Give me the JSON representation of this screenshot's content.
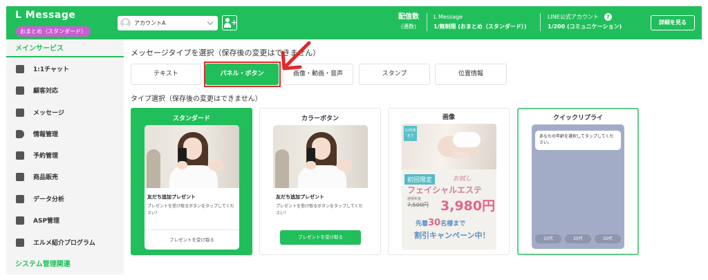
{
  "header": {
    "brand": "L Message",
    "plan_badge": "おまとめ（スタンダード）",
    "account_name": "アカウントA",
    "stats": {
      "delivery_label": "配信数",
      "delivery_sub": "(通数)",
      "plan_app": "L Message",
      "plan_value": "1/無制限 (おまとめ（スタンダード）)",
      "line_label": "LINE公式アカウント",
      "line_value": "1/200 (コミュニケーション)"
    },
    "detail_button": "詳細を見る"
  },
  "sidebar": {
    "main_section": "メインサービス",
    "items": [
      {
        "label": "1:1チャット",
        "icon": "chat-icon"
      },
      {
        "label": "顧客対応",
        "icon": "edit-icon"
      },
      {
        "label": "メッセージ",
        "icon": "message-icon"
      },
      {
        "label": "情報管理",
        "icon": "tag-icon"
      },
      {
        "label": "予約管理",
        "icon": "calendar-icon"
      },
      {
        "label": "商品販売",
        "icon": "cart-icon"
      },
      {
        "label": "データ分析",
        "icon": "chart-icon"
      },
      {
        "label": "ASP管理",
        "icon": "asp-icon"
      },
      {
        "label": "エルメ紹介プログラム",
        "icon": "badge-icon"
      }
    ],
    "system_section": "システム管理関連"
  },
  "main": {
    "message_type_title": "メッセージタイプを選択（保存後の変更はできません）",
    "message_types": [
      "テキスト",
      "パネル・ボタン",
      "画像・動画・音声",
      "スタンプ",
      "位置情報"
    ],
    "selected_message_type": "パネル・ボタン",
    "type_select_title": "タイプ選択（保存後の変更はできません）",
    "cards": [
      {
        "title": "スタンダード",
        "item_title": "友だち追加プレゼント",
        "item_desc": "プレゼントを受け取るボタンをタップしてください！",
        "button": "プレゼントを受け取る"
      },
      {
        "title": "カラーボタン",
        "item_title": "友だち追加プレゼント",
        "item_desc": "プレゼントを受け取るボタンをタップしてください！",
        "button": "プレゼントを受け取る"
      },
      {
        "title": "画像"
      },
      {
        "title": "クイックリプライ",
        "bubble": "あなたの年齢を選択してタップしてください。",
        "chips": [
          "10代",
          "20代",
          "30代"
        ]
      }
    ],
    "poster": {
      "tag": "12月末まで",
      "limited": "初回限定",
      "trial": "お試し",
      "name": "フェイシャルエステ",
      "regular_label": "通常料金",
      "regular_price": "7,500円",
      "price": "3,980円",
      "first": "先着",
      "first_count": "30",
      "first_suffix": "名様まで",
      "campaign": "割引キャンペーン中！"
    }
  },
  "colors": {
    "accent": "#21bf5b",
    "badge": "#c85fd0",
    "highlight": "#e02a2a"
  }
}
